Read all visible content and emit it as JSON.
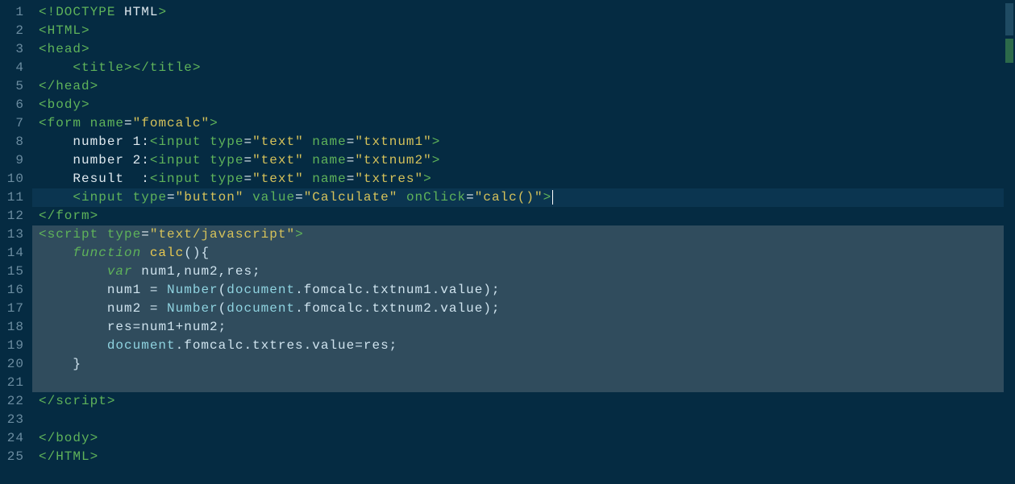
{
  "editor": {
    "line_count": 25,
    "current_line": 11,
    "selection_start": 13,
    "selection_end": 21,
    "gutter": [
      "1",
      "2",
      "3",
      "4",
      "5",
      "6",
      "7",
      "8",
      "9",
      "10",
      "11",
      "12",
      "13",
      "14",
      "15",
      "16",
      "17",
      "18",
      "19",
      "20",
      "21",
      "22",
      "23",
      "24",
      "25"
    ],
    "lines": {
      "l1": [
        {
          "t": "<!",
          "c": "tag"
        },
        {
          "t": "DOCTYPE",
          "c": "tag"
        },
        {
          "t": " HTML",
          "c": "txt"
        },
        {
          "t": ">",
          "c": "tag"
        }
      ],
      "l2": [
        {
          "t": "<",
          "c": "tag"
        },
        {
          "t": "HTML",
          "c": "tag"
        },
        {
          "t": ">",
          "c": "tag"
        }
      ],
      "l3": [
        {
          "t": "<",
          "c": "tag"
        },
        {
          "t": "head",
          "c": "tag"
        },
        {
          "t": ">",
          "c": "tag"
        }
      ],
      "l4": [
        {
          "t": "    ",
          "c": "txt"
        },
        {
          "t": "<",
          "c": "tag"
        },
        {
          "t": "title",
          "c": "tag"
        },
        {
          "t": ">",
          "c": "tag"
        },
        {
          "t": "</",
          "c": "tag"
        },
        {
          "t": "title",
          "c": "tag"
        },
        {
          "t": ">",
          "c": "tag"
        }
      ],
      "l5": [
        {
          "t": "</",
          "c": "tag"
        },
        {
          "t": "head",
          "c": "tag"
        },
        {
          "t": ">",
          "c": "tag"
        }
      ],
      "l6": [
        {
          "t": "<",
          "c": "tag"
        },
        {
          "t": "body",
          "c": "tag"
        },
        {
          "t": ">",
          "c": "tag"
        }
      ],
      "l7": [
        {
          "t": "<",
          "c": "tag"
        },
        {
          "t": "form",
          "c": "tag"
        },
        {
          "t": " ",
          "c": "txt"
        },
        {
          "t": "name",
          "c": "attr"
        },
        {
          "t": "=",
          "c": "txt"
        },
        {
          "t": "\"fomcalc\"",
          "c": "str"
        },
        {
          "t": ">",
          "c": "tag"
        }
      ],
      "l8": [
        {
          "t": "    number 1:",
          "c": "txt"
        },
        {
          "t": "<",
          "c": "tag"
        },
        {
          "t": "input",
          "c": "tag"
        },
        {
          "t": " ",
          "c": "txt"
        },
        {
          "t": "type",
          "c": "attr"
        },
        {
          "t": "=",
          "c": "txt"
        },
        {
          "t": "\"text\"",
          "c": "str"
        },
        {
          "t": " ",
          "c": "txt"
        },
        {
          "t": "name",
          "c": "attr"
        },
        {
          "t": "=",
          "c": "txt"
        },
        {
          "t": "\"txtnum1\"",
          "c": "str"
        },
        {
          "t": ">",
          "c": "tag"
        }
      ],
      "l9": [
        {
          "t": "    number 2:",
          "c": "txt"
        },
        {
          "t": "<",
          "c": "tag"
        },
        {
          "t": "input",
          "c": "tag"
        },
        {
          "t": " ",
          "c": "txt"
        },
        {
          "t": "type",
          "c": "attr"
        },
        {
          "t": "=",
          "c": "txt"
        },
        {
          "t": "\"text\"",
          "c": "str"
        },
        {
          "t": " ",
          "c": "txt"
        },
        {
          "t": "name",
          "c": "attr"
        },
        {
          "t": "=",
          "c": "txt"
        },
        {
          "t": "\"txtnum2\"",
          "c": "str"
        },
        {
          "t": ">",
          "c": "tag"
        }
      ],
      "l10": [
        {
          "t": "    Result  :",
          "c": "txt"
        },
        {
          "t": "<",
          "c": "tag"
        },
        {
          "t": "input",
          "c": "tag"
        },
        {
          "t": " ",
          "c": "txt"
        },
        {
          "t": "type",
          "c": "attr"
        },
        {
          "t": "=",
          "c": "txt"
        },
        {
          "t": "\"text\"",
          "c": "str"
        },
        {
          "t": " ",
          "c": "txt"
        },
        {
          "t": "name",
          "c": "attr"
        },
        {
          "t": "=",
          "c": "txt"
        },
        {
          "t": "\"txtres\"",
          "c": "str"
        },
        {
          "t": ">",
          "c": "tag"
        }
      ],
      "l11": [
        {
          "t": "    ",
          "c": "txt"
        },
        {
          "t": "<",
          "c": "tag"
        },
        {
          "t": "input",
          "c": "tag"
        },
        {
          "t": " ",
          "c": "txt"
        },
        {
          "t": "type",
          "c": "attr"
        },
        {
          "t": "=",
          "c": "txt"
        },
        {
          "t": "\"button\"",
          "c": "str"
        },
        {
          "t": " ",
          "c": "txt"
        },
        {
          "t": "value",
          "c": "attr"
        },
        {
          "t": "=",
          "c": "txt"
        },
        {
          "t": "\"Calculate\"",
          "c": "str"
        },
        {
          "t": " ",
          "c": "txt"
        },
        {
          "t": "onClick",
          "c": "attr"
        },
        {
          "t": "=",
          "c": "txt"
        },
        {
          "t": "\"calc()\"",
          "c": "str"
        },
        {
          "t": ">",
          "c": "tag"
        }
      ],
      "l12": [
        {
          "t": "</",
          "c": "tag"
        },
        {
          "t": "form",
          "c": "tag"
        },
        {
          "t": ">",
          "c": "tag"
        }
      ],
      "l13": [
        {
          "t": "<",
          "c": "tag"
        },
        {
          "t": "script",
          "c": "tag"
        },
        {
          "t": " ",
          "c": "txt"
        },
        {
          "t": "type",
          "c": "attr"
        },
        {
          "t": "=",
          "c": "txt"
        },
        {
          "t": "\"text/javascript\"",
          "c": "str"
        },
        {
          "t": ">",
          "c": "tag"
        }
      ],
      "l14": [
        {
          "t": "    ",
          "c": "txt"
        },
        {
          "t": "function",
          "c": "kw"
        },
        {
          "t": " ",
          "c": "txt"
        },
        {
          "t": "calc",
          "c": "fn"
        },
        {
          "t": "(){",
          "c": "punct"
        }
      ],
      "l15": [
        {
          "t": "        ",
          "c": "txt"
        },
        {
          "t": "var",
          "c": "kw"
        },
        {
          "t": " num1,num2,res;",
          "c": "id"
        }
      ],
      "l16": [
        {
          "t": "        num1 ",
          "c": "id"
        },
        {
          "t": "=",
          "c": "op"
        },
        {
          "t": " ",
          "c": "txt"
        },
        {
          "t": "Number",
          "c": "builtin"
        },
        {
          "t": "(",
          "c": "punct"
        },
        {
          "t": "document",
          "c": "builtin"
        },
        {
          "t": ".fomcalc.txtnum1.value);",
          "c": "id"
        }
      ],
      "l17": [
        {
          "t": "        num2 ",
          "c": "id"
        },
        {
          "t": "=",
          "c": "op"
        },
        {
          "t": " ",
          "c": "txt"
        },
        {
          "t": "Number",
          "c": "builtin"
        },
        {
          "t": "(",
          "c": "punct"
        },
        {
          "t": "document",
          "c": "builtin"
        },
        {
          "t": ".fomcalc.txtnum2.value);",
          "c": "id"
        }
      ],
      "l18": [
        {
          "t": "        res",
          "c": "id"
        },
        {
          "t": "=",
          "c": "op"
        },
        {
          "t": "num1",
          "c": "id"
        },
        {
          "t": "+",
          "c": "op"
        },
        {
          "t": "num2;",
          "c": "id"
        }
      ],
      "l19": [
        {
          "t": "        ",
          "c": "txt"
        },
        {
          "t": "document",
          "c": "builtin"
        },
        {
          "t": ".fomcalc.txtres.value",
          "c": "id"
        },
        {
          "t": "=",
          "c": "op"
        },
        {
          "t": "res;",
          "c": "id"
        }
      ],
      "l20": [
        {
          "t": "    }",
          "c": "punct"
        }
      ],
      "l21": [
        {
          "t": "",
          "c": "txt"
        }
      ],
      "l22": [
        {
          "t": "</",
          "c": "tag"
        },
        {
          "t": "script",
          "c": "tag"
        },
        {
          "t": ">",
          "c": "tag"
        }
      ],
      "l23": [
        {
          "t": "",
          "c": "txt"
        }
      ],
      "l24": [
        {
          "t": "</",
          "c": "tag"
        },
        {
          "t": "body",
          "c": "tag"
        },
        {
          "t": ">",
          "c": "tag"
        }
      ],
      "l25": [
        {
          "t": "</",
          "c": "tag"
        },
        {
          "t": "HTML",
          "c": "tag"
        },
        {
          "t": ">",
          "c": "tag"
        }
      ]
    }
  }
}
